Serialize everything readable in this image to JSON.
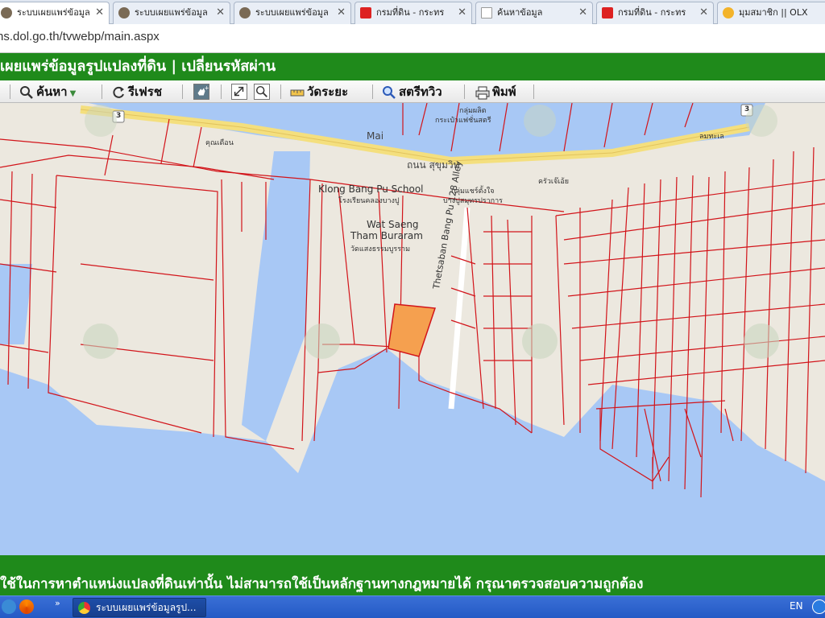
{
  "browser": {
    "tabs": [
      {
        "label": "ระบบเผยแพร่ข้อมูล",
        "active": true,
        "favicon": "dol-seal-icon"
      },
      {
        "label": "ระบบเผยแพร่ข้อมูล",
        "active": false,
        "favicon": "dol-seal-icon"
      },
      {
        "label": "ระบบเผยแพร่ข้อมูล",
        "active": false,
        "favicon": "dol-seal-icon"
      },
      {
        "label": "กรมที่ดิน - กระทร",
        "active": false,
        "favicon": "dol-red-icon"
      },
      {
        "label": "ค้นหาข้อมูล",
        "active": false,
        "favicon": "page-icon"
      },
      {
        "label": "กรมที่ดิน - กระทร",
        "active": false,
        "favicon": "dol-red-icon"
      },
      {
        "label": "มุมสมาชิก || OLX",
        "active": false,
        "favicon": "olx-icon"
      }
    ],
    "url": "ns.dol.go.th/tvwebp/main.aspx"
  },
  "app": {
    "title": "เผยแพร่ข้อมูลรูปแปลงที่ดิน  |  เปลี่ยนรหัสผ่าน"
  },
  "toolbar": {
    "search_label": "ค้นหา",
    "refresh_label": "รีเฟรช",
    "measure_label": "วัดระยะ",
    "streetview_label": "สตรีทวิว",
    "print_label": "พิมพ์"
  },
  "map": {
    "labels": {
      "mai": "Mai",
      "sukhumvit": "ถนน สุขุมวิท",
      "school": "Klong Bang Pu School",
      "school_th": "โรงเรียนคลองบางปู",
      "wat_line1": "Wat Saeng",
      "wat_line2": "Tham Buraram",
      "wat_th": "วัดแสงธรรมบูรราม",
      "alley": "Thetsaban Bang Pu 128 Alley",
      "kuntuen": "คุณเดือน",
      "shop1": "กลุ่มผลิต",
      "shop2": "กระเป๋าแฟชั่นสตรี",
      "temple_pink": "กลุ่มแชร์ตั้งใจ",
      "temple_pink2": "บางปูสมุทรปราการ",
      "restaurant": "ครัวเจ๊เอ้ย",
      "shop3": "ลมทะเล",
      "route": "3"
    },
    "colors": {
      "land": "#ece8df",
      "water": "#a8c8f5",
      "road": "#f4df7e",
      "parcel_line": "#d2141a",
      "selected_parcel": "#f5a04f"
    }
  },
  "disclaimer": "ใช้ในการหาตำแหน่งแปลงที่ดินเท่านั้น ไม่สามารถใช้เป็นหลักฐานทางกฎหมายได้ กรุณาตรวจสอบความถูกต้อง",
  "taskbar": {
    "task_label": "ระบบเผยแพร่ข้อมูลรูป...",
    "language": "EN"
  }
}
